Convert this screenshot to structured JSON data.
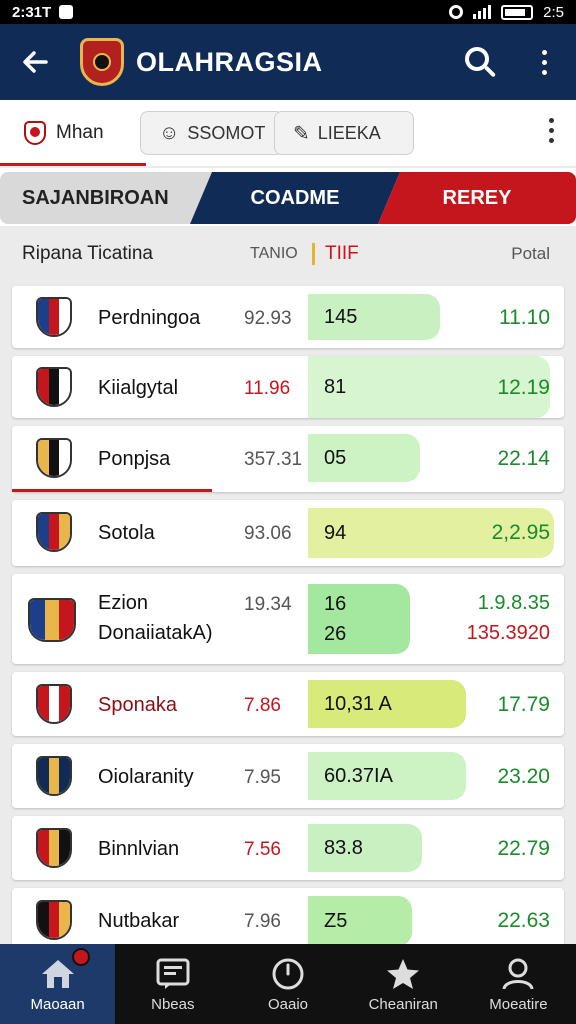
{
  "status_bar": {
    "time": "2:31T",
    "right_time": "2:5"
  },
  "app_bar": {
    "title": "OLAHRAGSIA"
  },
  "sub_bar": {
    "active_tab_label": "Mhan",
    "chip_1_label": "SSOMOT",
    "chip_2_label": "LIEEKA"
  },
  "segments": {
    "left": "SAJANBIROAN",
    "middle": "COADME",
    "right": "REREY"
  },
  "columns": {
    "name": "Ripana Ticatina",
    "stat": "TANIO",
    "score": "TIIF",
    "total": "Potal"
  },
  "rows": [
    {
      "name": "Perdningoa",
      "stat": "92.93",
      "score": "145",
      "total": "11.10",
      "pill_color": "#c8f0c0",
      "crest": [
        "#1d3f8a",
        "#c4161c",
        "#ffffff"
      ]
    },
    {
      "name": "Kiialgytal",
      "stat": "11.96",
      "score": "81",
      "total": "12.19",
      "pill_color": "#d7f5cf",
      "crest": [
        "#c4161c",
        "#111111",
        "#ffffff"
      ]
    },
    {
      "name": "Ponpjsa",
      "stat": "357.31",
      "score": "05",
      "total": "22.14",
      "pill_color": "#cdf2c4",
      "crest": [
        "#e8b64a",
        "#111111",
        "#ffffff"
      ]
    },
    {
      "name": "Sotola",
      "stat": "93.06",
      "score": "94",
      "total": "2,2.95",
      "pill_color": "#e2f0a0",
      "crest": [
        "#1d3f8a",
        "#c4161c",
        "#e8b64a"
      ]
    },
    {
      "name": "Ezion",
      "name2": "DonaiiatakA)",
      "stat": "19.34",
      "score": "16",
      "score2": "26",
      "total": "1.9.8.35",
      "total2": "135.3920",
      "pill_color": "#a4e8a0",
      "crest": [
        "#1d3f8a",
        "#e8b64a",
        "#c4161c"
      ]
    },
    {
      "name": "Sponaka",
      "stat": "7.86",
      "score": "10,31 A",
      "total": "17.79",
      "pill_color": "#d8ea7a",
      "crest": [
        "#c4161c",
        "#ffffff",
        "#c4161c"
      ]
    },
    {
      "name": "Oiolaranity",
      "stat": "7.95",
      "score": "60.37IA",
      "total": "23.20",
      "pill_color": "#cdf2c4",
      "crest": [
        "#0f2b56",
        "#e8b64a",
        "#0f2b56"
      ]
    },
    {
      "name": "Binnlvian",
      "stat": "7.56",
      "score": "83.8",
      "total": "22.79",
      "pill_color": "#c8f0c0",
      "crest": [
        "#c4161c",
        "#e8b64a",
        "#111111"
      ]
    },
    {
      "name": "Nutbakar",
      "stat": "7.96",
      "score": "Z5",
      "total": "22.63",
      "pill_color": "#b4eca8",
      "crest": [
        "#111111",
        "#c4161c",
        "#e8b64a"
      ]
    }
  ],
  "bottom_nav": [
    {
      "label": "Maoaan",
      "icon": "home-icon"
    },
    {
      "label": "Nbeas",
      "icon": "news-icon"
    },
    {
      "label": "Oaaio",
      "icon": "clock-icon"
    },
    {
      "label": "Cheaniran",
      "icon": "star-icon"
    },
    {
      "label": "Moeatire",
      "icon": "profile-icon"
    }
  ],
  "colors": {
    "navy": "#0f2b56",
    "red": "#c4161c",
    "green_text": "#1a8a2a"
  }
}
